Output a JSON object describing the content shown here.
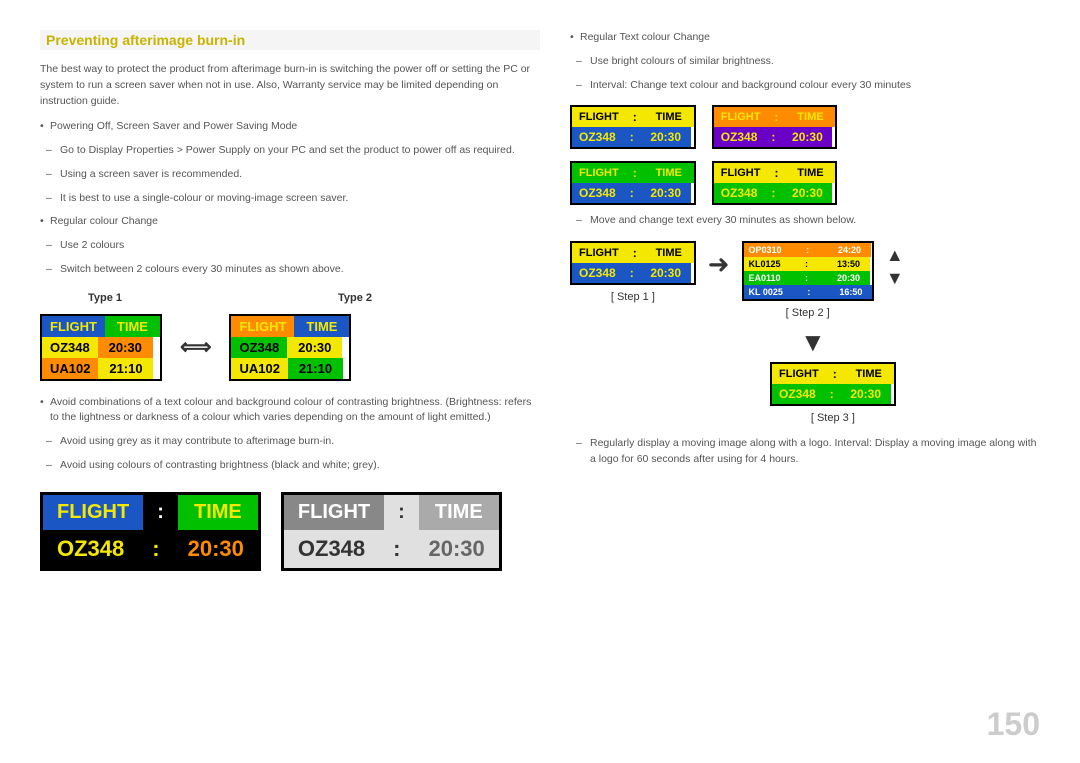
{
  "page": {
    "number": "150"
  },
  "header": {
    "title": "Preventing afterimage burn-in"
  },
  "intro_text": "The best way to protect the product from afterimage burn-in is switching the power off or setting the PC or system to run a screen saver when not in use. Also, Warranty service may be limited depending on instruction guide.",
  "bullets": {
    "b1": "Powering Off, Screen Saver and Power Saving Mode",
    "b1d1": "Go to Display Properties > Power Supply on your PC and set the product to power off as required.",
    "b1d2": "Using a screen saver is recommended.",
    "b1d3": "It is best to use a single-colour or moving-image screen saver.",
    "b2": "Regular colour Change",
    "b2d1": "Use 2 colours",
    "b2d2": "Switch between 2 colours every 30 minutes as shown above."
  },
  "type1_label": "Type 1",
  "type2_label": "Type 2",
  "type1_board": {
    "row1": [
      "FLIGHT",
      "TIME"
    ],
    "row2": [
      "OZ348",
      "20:30"
    ],
    "row3": [
      "UA102",
      "21:10"
    ]
  },
  "type2_board": {
    "row1": [
      "FLIGHT",
      "TIME"
    ],
    "row2": [
      "OZ348",
      "20:30"
    ],
    "row3": [
      "UA102",
      "21:10"
    ]
  },
  "avoid_text1": "Avoid combinations of a text colour and background colour of contrasting brightness. (Brightness: refers to the lightness or darkness of a colour which varies depending on the amount of light emitted.)",
  "avoid_text2": "Avoid using grey as it may contribute to afterimage burn-in.",
  "avoid_text3": "Avoid using colours of contrasting brightness (black and white; grey).",
  "large_board1": {
    "row1": [
      "FLIGHT",
      ":",
      "TIME"
    ],
    "row2": [
      "OZ348",
      ":",
      "20:30"
    ]
  },
  "large_board2": {
    "row1": [
      "FLIGHT",
      ":",
      "TIME"
    ],
    "row2": [
      "OZ348",
      ":",
      "20:30"
    ]
  },
  "right_header": {
    "bullet": "Regular Text colour Change",
    "dash1": "Use bright colours of similar brightness.",
    "dash2": "Interval: Change text colour and background colour every 30 minutes"
  },
  "right_boards": {
    "board1": {
      "r1": [
        "FLIGHT",
        ":",
        "TIME"
      ],
      "r2": [
        "OZ348",
        ":",
        "20:30"
      ]
    },
    "board2": {
      "r1": [
        "FLIGHT",
        ":",
        "TIME"
      ],
      "r2": [
        "OZ348",
        ":",
        "20:30"
      ]
    },
    "board3": {
      "r1": [
        "FLIGHT",
        ":",
        "TIME"
      ],
      "r2": [
        "OZ348",
        ":",
        "20:30"
      ]
    },
    "board4": {
      "r1": [
        "FLIGHT",
        ":",
        "TIME"
      ],
      "r2": [
        "OZ348",
        ":",
        "20:30"
      ]
    }
  },
  "move_text": "Move and change text every 30 minutes as shown below.",
  "step1_label": "[ Step 1 ]",
  "step2_label": "[ Step 2 ]",
  "step3_label": "[ Step 3 ]",
  "step1_board": {
    "r1": [
      "FLIGHT",
      ":",
      "TIME"
    ],
    "r2": [
      "OZ348",
      ":",
      "20:30"
    ]
  },
  "step2_board": {
    "r1": [
      "OP0310",
      ":",
      "24:20"
    ],
    "r2": [
      "KL0125",
      ":",
      "13:50"
    ],
    "r3": [
      "EA0110",
      ":",
      "20:30"
    ],
    "r4": [
      "KL 0025",
      ":",
      "16:50"
    ]
  },
  "step3_board": {
    "r1": [
      "FLIGHT",
      ":",
      "TIME"
    ],
    "r2": [
      "OZ348",
      ":",
      "20:30"
    ]
  },
  "footer_text": "Regularly display a moving image along with a logo. Interval: Display a moving image along with a logo for 60 seconds after using for 4 hours."
}
